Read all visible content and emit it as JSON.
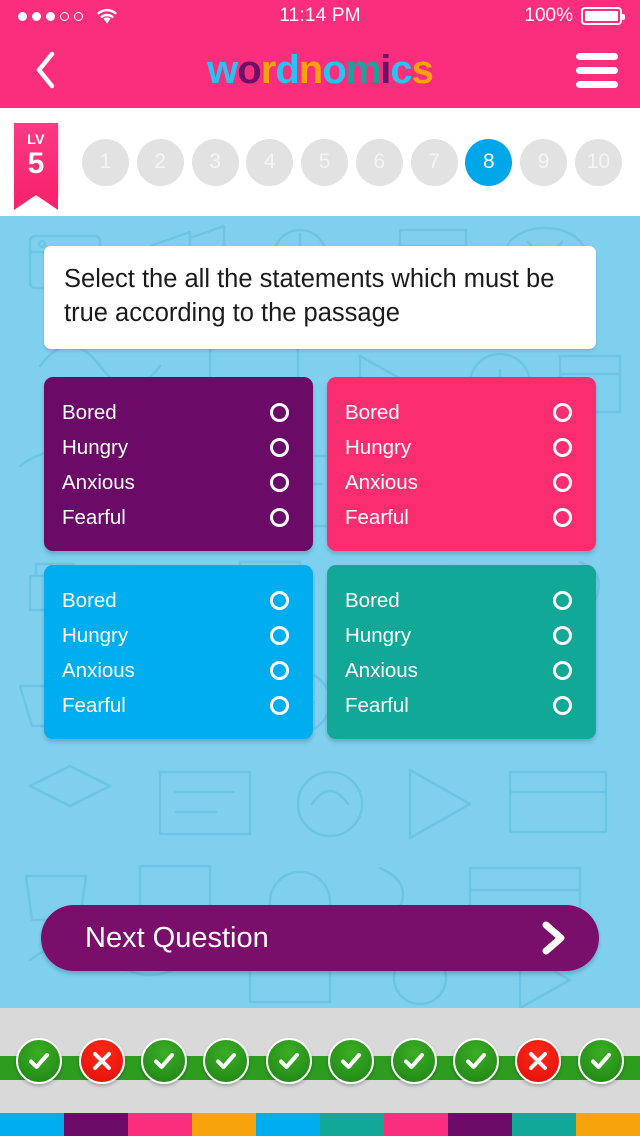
{
  "status_bar": {
    "signal_dots_filled": 3,
    "signal_dots_total": 5,
    "wifi_icon": "wifi-icon",
    "time": "11:14 PM",
    "battery_percent": "100%",
    "battery_icon": "battery-full-icon"
  },
  "nav": {
    "back_icon": "chevron-left-icon",
    "menu_icon": "hamburger-menu-icon",
    "logo_text": "wordnomics",
    "logo_letters": [
      {
        "ch": "w",
        "color": "#29c2f2"
      },
      {
        "ch": "o",
        "color": "#6b1168"
      },
      {
        "ch": "r",
        "color": "#f7a30c"
      },
      {
        "ch": "d",
        "color": "#29c2f2"
      },
      {
        "ch": "n",
        "color": "#f7a30c"
      },
      {
        "ch": "o",
        "color": "#29c2f2"
      },
      {
        "ch": "m",
        "color": "#12a79d"
      },
      {
        "ch": "i",
        "color": "#6b1168"
      },
      {
        "ch": "c",
        "color": "#29c2f2"
      },
      {
        "ch": "s",
        "color": "#f7a30c"
      }
    ],
    "bar_color": "#fb2d7d"
  },
  "level": {
    "badge_label": "LV",
    "badge_value": "5",
    "badge_color": "#f8246f",
    "steps": [
      {
        "label": "1",
        "active": false
      },
      {
        "label": "2",
        "active": false
      },
      {
        "label": "3",
        "active": false
      },
      {
        "label": "4",
        "active": false
      },
      {
        "label": "5",
        "active": false
      },
      {
        "label": "6",
        "active": false
      },
      {
        "label": "7",
        "active": false
      },
      {
        "label": "8",
        "active": true
      },
      {
        "label": "9",
        "active": false
      },
      {
        "label": "10",
        "active": false
      }
    ],
    "active_color": "#00a7e8",
    "inactive_color": "#e2e2e2"
  },
  "quiz": {
    "background_color": "#7fd0ef",
    "question": "Select the all the statements which must be true according to the passage",
    "answer_cards": [
      {
        "name": "answer-card-purple",
        "color": "#6b0a67",
        "options": [
          {
            "label": "Bored",
            "selected": false
          },
          {
            "label": "Hungry",
            "selected": false
          },
          {
            "label": "Anxious",
            "selected": false
          },
          {
            "label": "Fearful",
            "selected": false
          }
        ]
      },
      {
        "name": "answer-card-pink",
        "color": "#fb2d71",
        "options": [
          {
            "label": "Bored",
            "selected": false
          },
          {
            "label": "Hungry",
            "selected": false
          },
          {
            "label": "Anxious",
            "selected": false
          },
          {
            "label": "Fearful",
            "selected": false
          }
        ]
      },
      {
        "name": "answer-card-blue",
        "color": "#00aeef",
        "options": [
          {
            "label": "Bored",
            "selected": false
          },
          {
            "label": "Hungry",
            "selected": false
          },
          {
            "label": "Anxious",
            "selected": false
          },
          {
            "label": "Fearful",
            "selected": false
          }
        ]
      },
      {
        "name": "answer-card-teal",
        "color": "#12a898",
        "options": [
          {
            "label": "Bored",
            "selected": false
          },
          {
            "label": "Hungry",
            "selected": false
          },
          {
            "label": "Anxious",
            "selected": false
          },
          {
            "label": "Fearful",
            "selected": false
          }
        ]
      }
    ],
    "next_button": {
      "label": "Next Question",
      "icon": "chevron-right-icon",
      "color": "#7a0e6b"
    }
  },
  "results": {
    "bar_color": "#d9d9d9",
    "line_color": "#2d9c1f",
    "correct_color": "#2d9c1f",
    "wrong_color": "#e8150b",
    "marks": [
      "correct",
      "wrong",
      "correct",
      "correct",
      "correct",
      "correct",
      "correct",
      "correct",
      "wrong",
      "correct"
    ]
  },
  "footer_strip": {
    "colors": [
      "#00aeef",
      "#6b0a67",
      "#fb2d7d",
      "#f7a30c",
      "#00aeef",
      "#12a898",
      "#fb2d7d",
      "#6b0a67",
      "#12a898",
      "#f7a30c"
    ]
  }
}
